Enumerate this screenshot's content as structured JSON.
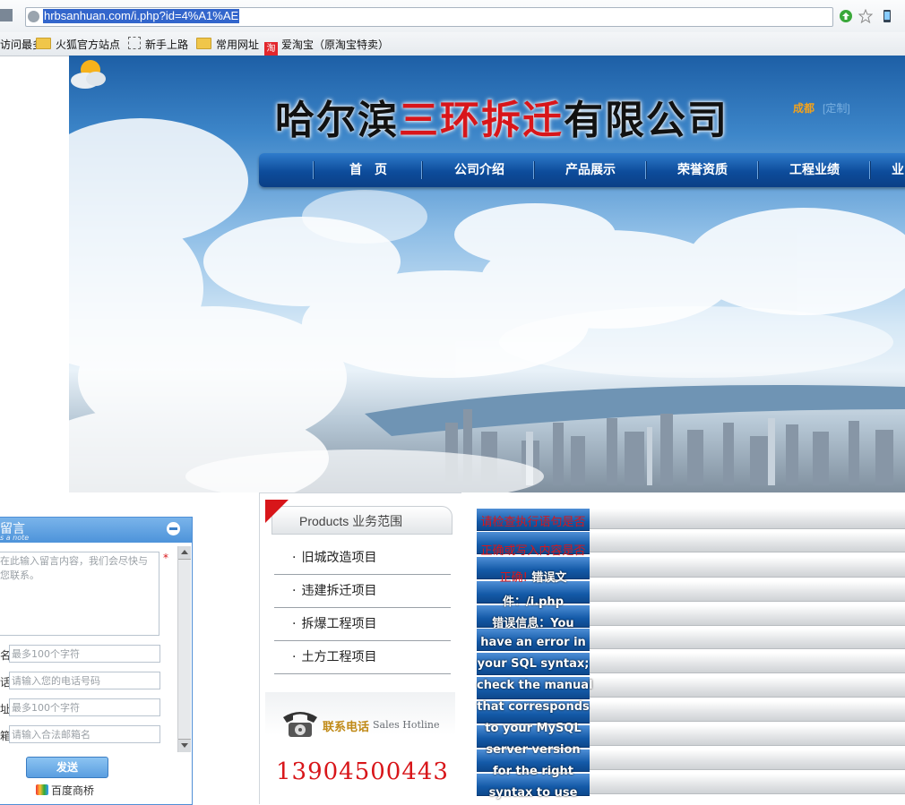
{
  "browser": {
    "url": "hrbsanhuan.com/i.php?id=4%A1%AE",
    "bookmarks": [
      {
        "label": "访问最多",
        "icon": "none"
      },
      {
        "label": "火狐官方站点",
        "icon": "folder-icon"
      },
      {
        "label": "新手上路",
        "icon": "dashed-icon"
      },
      {
        "label": "常用网址",
        "icon": "folder-icon"
      },
      {
        "label": "爱淘宝（原淘宝特卖）",
        "icon": "taobao-icon"
      }
    ]
  },
  "header": {
    "company_pre": "哈尔滨",
    "company_red": "三环拆迁",
    "company_post": "有限公司",
    "city": "成都",
    "customize": "[定制]"
  },
  "nav": {
    "items": [
      "首　页",
      "公司介绍",
      "产品展示",
      "荣誉资质",
      "工程业绩",
      "业"
    ]
  },
  "products": {
    "title": "Products 业务范围",
    "items": [
      "旧城改造项目",
      "违建拆迁项目",
      "拆爆工程项目",
      "土方工程项目"
    ],
    "hotline_label": "联系电话",
    "hotline_en": "Sales Hotline",
    "hotline_number": "13904500443"
  },
  "error": {
    "lines": [
      {
        "text": "请检查执行语句是否",
        "style": "red"
      },
      {
        "text": "正确或写入内容是否",
        "style": "red"
      },
      {
        "text": "正确! 错误文",
        "style": "mixed"
      },
      {
        "text": "件：/i.php",
        "style": "white"
      },
      {
        "text": "错误信息：You",
        "style": "white"
      },
      {
        "text": "have an error in",
        "style": "white"
      },
      {
        "text": "your SQL syntax;",
        "style": "white"
      },
      {
        "text": "check the manual",
        "style": "white"
      },
      {
        "text": "that corresponds",
        "style": "white"
      },
      {
        "text": "to your MySQL",
        "style": "white"
      },
      {
        "text": "server version",
        "style": "white"
      },
      {
        "text": "for the right",
        "style": "white"
      },
      {
        "text": "syntax to use",
        "style": "white"
      }
    ]
  },
  "message_widget": {
    "title": "留言",
    "subtitle": "s a note",
    "textarea_placeholder": "在此输入留言内容，我们会尽快与您联系。",
    "fields": [
      {
        "label": "名",
        "placeholder": "最多100个字符"
      },
      {
        "label": "话",
        "placeholder": "请输入您的电话号码"
      },
      {
        "label": "址",
        "placeholder": "最多100个字符"
      },
      {
        "label": "箱",
        "placeholder": "请输入合法邮箱名"
      }
    ],
    "send_label": "发送",
    "baidu_label": "百度商桥"
  }
}
